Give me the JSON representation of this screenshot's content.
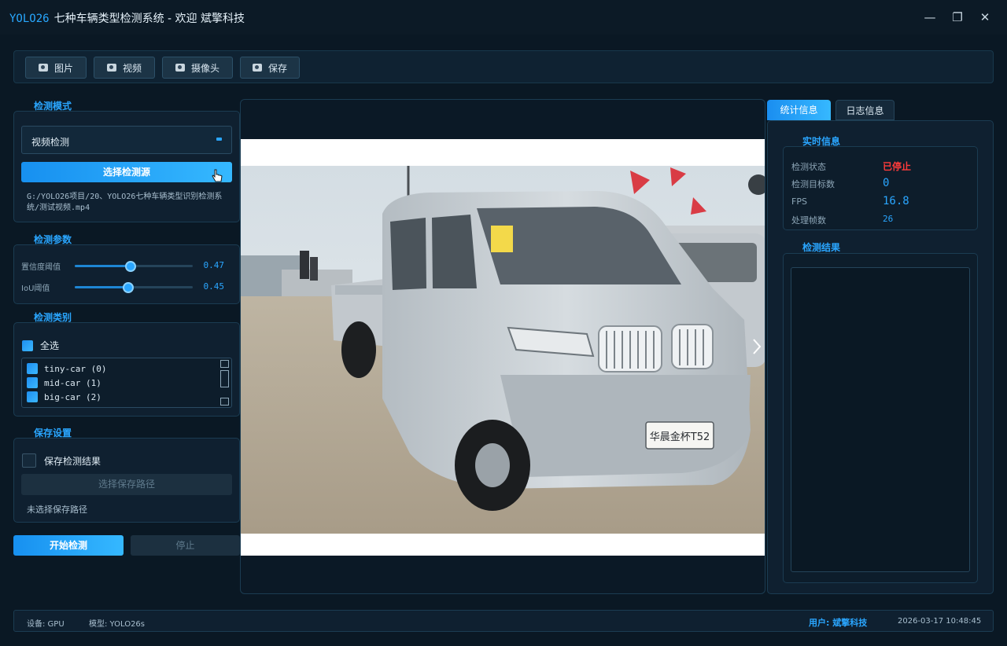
{
  "window": {
    "brand": "YOLO26",
    "title": "七种车辆类型检测系统 - 欢迎 斌擎科技",
    "minimize": "—",
    "maximize": "❐",
    "close": "✕"
  },
  "toolbar": {
    "image": "图片",
    "video": "视频",
    "camera": "摄像头",
    "save": "保存"
  },
  "detect_mode": {
    "label": "检测模式",
    "selected": "视频检测",
    "select_source": "选择检测源",
    "source_path": "G:/YOLO26项目/20、YOLO26七种车辆类型识别检测系统/测试视频.mp4"
  },
  "params": {
    "label": "检测参数",
    "conf_label": "置信度阈值",
    "conf_value": "0.47",
    "conf_level": 0.47,
    "iou_label": "IoU阈值",
    "iou_value": "0.45",
    "iou_level": 0.45
  },
  "classes": {
    "label": "检测类别",
    "select_all": "全选",
    "items": [
      {
        "label": "tiny-car (0)"
      },
      {
        "label": "mid-car (1)"
      },
      {
        "label": "big-car (2)"
      }
    ]
  },
  "save_settings": {
    "label": "保存设置",
    "save_results": "保存检测结果",
    "choose_path": "选择保存路径",
    "no_path": "未选择保存路径"
  },
  "actions": {
    "start": "开始检测",
    "stop": "停止"
  },
  "video": {
    "plate_text": "华晨金杯T52"
  },
  "tabs": {
    "stats": "统计信息",
    "log": "日志信息"
  },
  "realtime": {
    "label": "实时信息",
    "status_label": "检测状态",
    "status_value": "已停止",
    "count_label": "检测目标数",
    "count_value": "0",
    "fps_label": "FPS",
    "fps_value": "16.8",
    "frames_label": "处理帧数",
    "frames_value": "26"
  },
  "results": {
    "label": "检测结果"
  },
  "status_bar": {
    "device": "设备: GPU",
    "model": "模型: YOLO26s",
    "user": "用户: 斌擎科技",
    "datetime": "2026-03-17 10:48:45"
  },
  "colors": {
    "accent": "#2aa6ff",
    "stopped": "#ff3b3b",
    "background": "#0a1824"
  }
}
